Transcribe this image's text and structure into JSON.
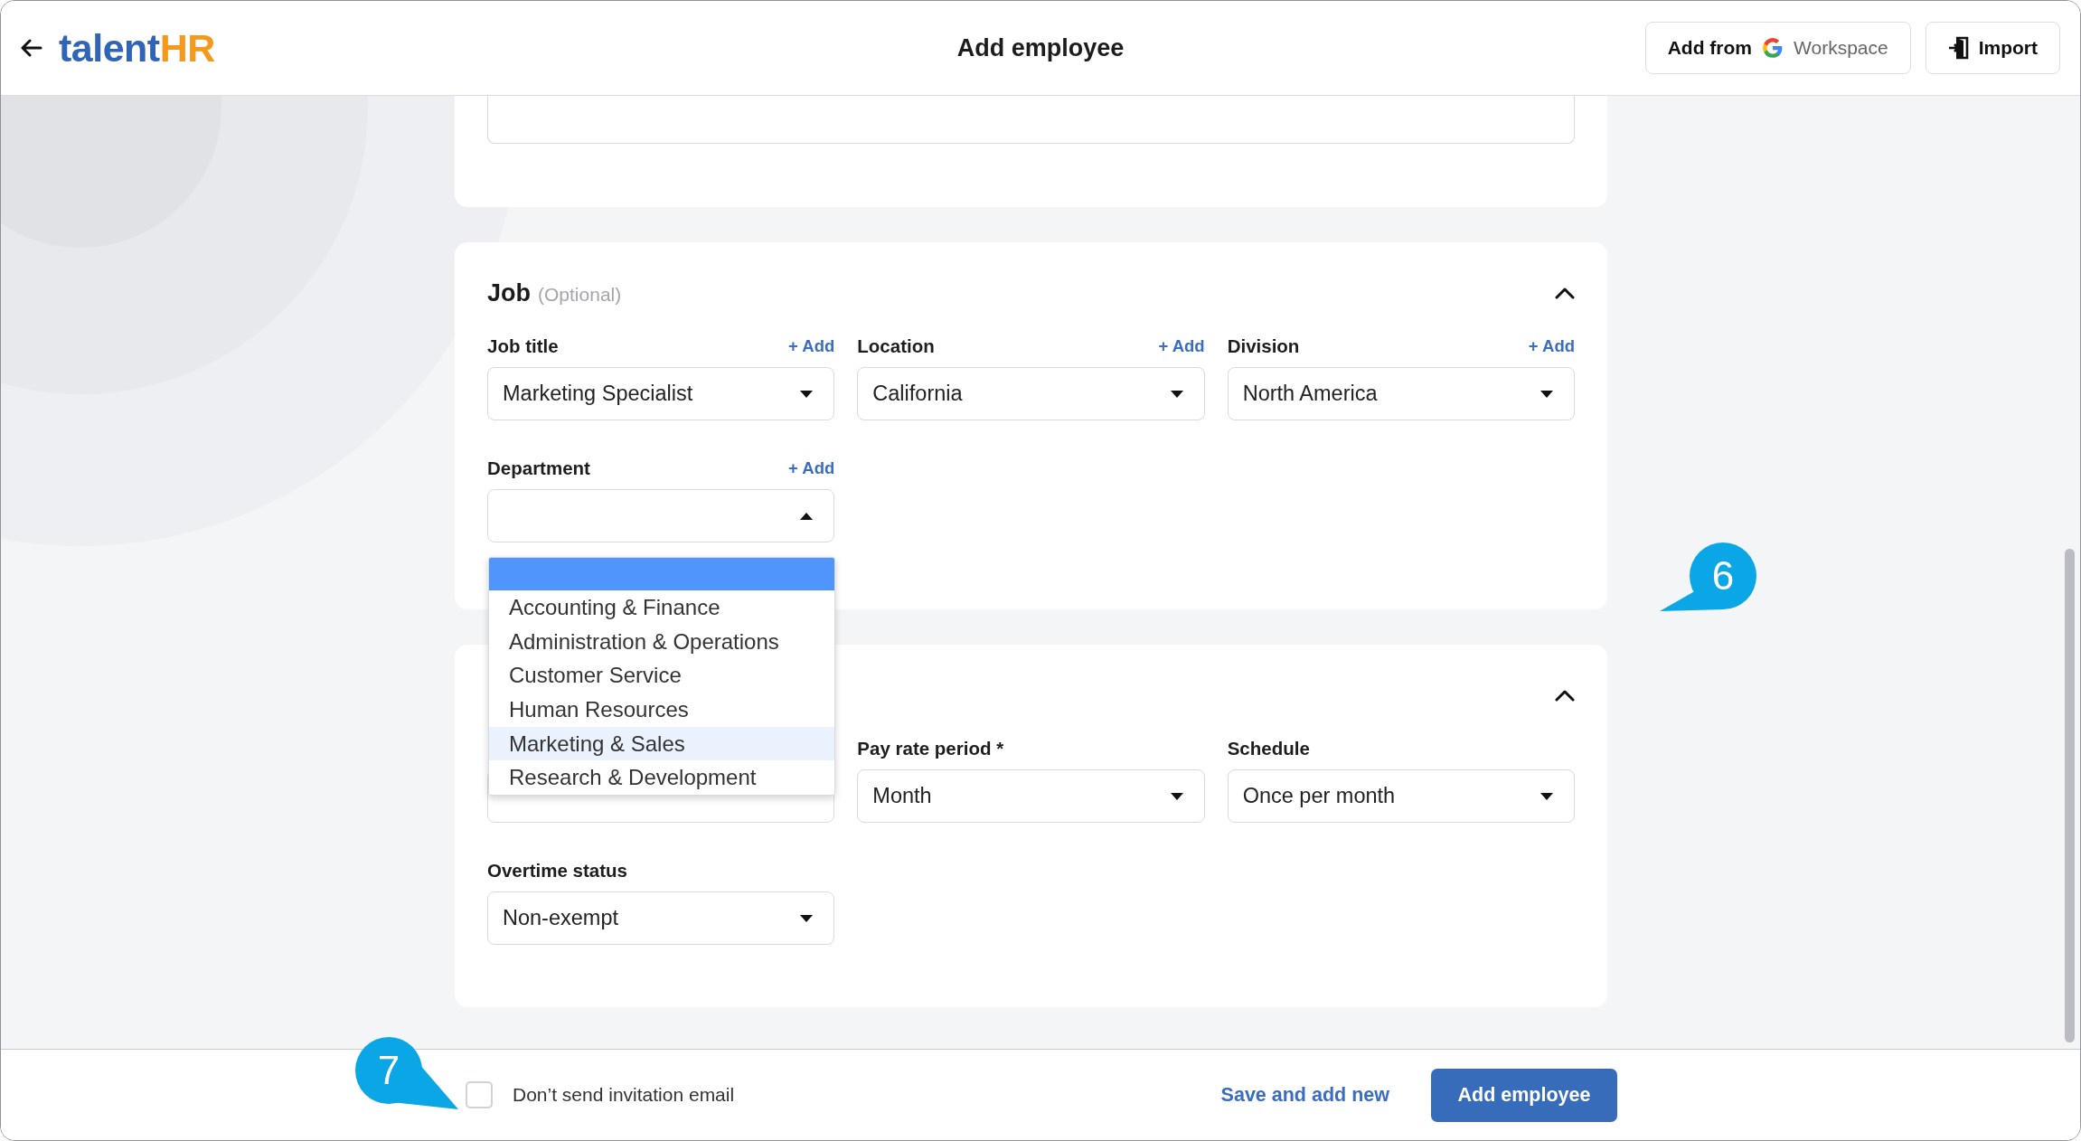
{
  "header": {
    "logo": {
      "text": "talent",
      "accent": "HR"
    },
    "title": "Add employee",
    "actions": [
      {
        "kind": "google",
        "label": "Add from",
        "sub": "Workspace"
      },
      {
        "kind": "import",
        "label": "Import"
      }
    ]
  },
  "job": {
    "title": "Job",
    "hint": "(Optional)",
    "expanded": true,
    "fields": [
      {
        "label": "Job title",
        "add": "+ Add",
        "value": "Marketing Specialist",
        "open": false
      },
      {
        "label": "Location",
        "add": "+ Add",
        "value": "California",
        "open": false
      },
      {
        "label": "Division",
        "add": "+ Add",
        "value": "North America",
        "open": false
      },
      {
        "label": "Department",
        "add": "+ Add",
        "open": true
      }
    ],
    "dropdown": {
      "options": [
        {
          "selected": true,
          "highlighted": false
        },
        {
          "label": "Accounting & Finance",
          "selected": false,
          "highlighted": false
        },
        {
          "label": "Administration & Operations",
          "selected": false,
          "highlighted": false
        },
        {
          "label": "Customer Service",
          "selected": false,
          "highlighted": false
        },
        {
          "label": "Human Resources",
          "selected": false,
          "highlighted": false
        },
        {
          "label": "Marketing & Sales",
          "selected": false,
          "highlighted": true
        },
        {
          "label": "Research & Development",
          "selected": false,
          "highlighted": false
        }
      ]
    }
  },
  "pay": {
    "expanded": true,
    "fields": [
      {
        "kind": "text"
      },
      {
        "kind": "select",
        "label": "Pay rate period *",
        "value": "Month",
        "open": false
      },
      {
        "kind": "select",
        "label": "Schedule",
        "value": "Once per month",
        "open": false
      },
      {
        "kind": "select",
        "label": "Overtime status",
        "value": "Non-exempt",
        "open": false
      }
    ]
  },
  "footer": {
    "checkbox": {
      "label": "Don’t send invitation email",
      "checked": false
    },
    "secondary": "Save and add new",
    "primary": "Add employee"
  },
  "callouts": [
    {
      "label": "6"
    },
    {
      "label": "7"
    }
  ]
}
